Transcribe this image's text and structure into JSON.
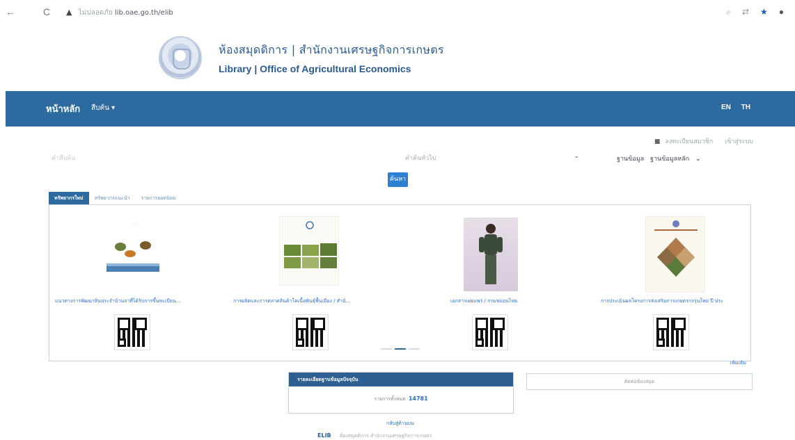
{
  "browser": {
    "back_icon": "←",
    "reload_icon": "C",
    "warning_icon": "▲",
    "security_text": "ไม่ปลอดภัย",
    "url": "lib.oae.go.th/elib",
    "icons": [
      "search-icon",
      "translate-icon",
      "star-icon",
      "profile-icon"
    ]
  },
  "header": {
    "title_th": "ห้องสมุดดิการ | สำนักงานเศรษฐกิจการเกษตร",
    "title_en": "Library | Office of Agricultural Economics"
  },
  "navbar": {
    "home": "หน้าหลัก",
    "search": "สืบค้น ▾",
    "lang_en": "EN",
    "lang_th": "TH"
  },
  "user_links": {
    "register": "ลงทะเบียนสมาชิก",
    "login": "เข้าสู่ระบบ"
  },
  "search": {
    "placeholder": "คำสืบค้น",
    "field": "คำค้นทั่วไป",
    "db_label": "ฐานข้อมูล",
    "db_value": "ฐานข้อมูลหลัก",
    "button": "ค้นหา"
  },
  "tabs": [
    {
      "label": "ทรัพยากรใหม่",
      "active": true
    },
    {
      "label": "ทรัพยากรแนะนำ",
      "active": false
    },
    {
      "label": "รายการยอดนิยม",
      "active": false
    }
  ],
  "items": [
    {
      "title": "แนวทางการพัฒนาสินประจำบ้านลาที่ได้รับการขึ้นทะเบียน..."
    },
    {
      "title": "การผลิตและการตลาดสินค้าโคเนื้อพันธุ์พื้นเมือง / สำนั..."
    },
    {
      "title": "เอกสารเผยแพร่ / กรมหม่อนไหม"
    },
    {
      "title": "การประเมินผลโครงการส่งเสริมการเกษตรกรรุ่นใหม่ ปี ประ"
    }
  ],
  "more": "เพิ่มเติม",
  "stats": {
    "heading": "รายละเอียดฐานข้อมูลปัจจุบัน",
    "label": "รายการทั้งหมด",
    "count": "14781"
  },
  "contact": "ติดต่อห้องสมุด",
  "back_top": "กลับสู่ด้านบน",
  "footer": {
    "brand": "ELIB",
    "text": "ห้องสมุดดิการ สำนักงานเศรษฐกิจการเกษตร"
  },
  "colors": {
    "navbar": "#2d6aa0",
    "link": "#2a6ec8",
    "button": "#2d7fd2"
  }
}
